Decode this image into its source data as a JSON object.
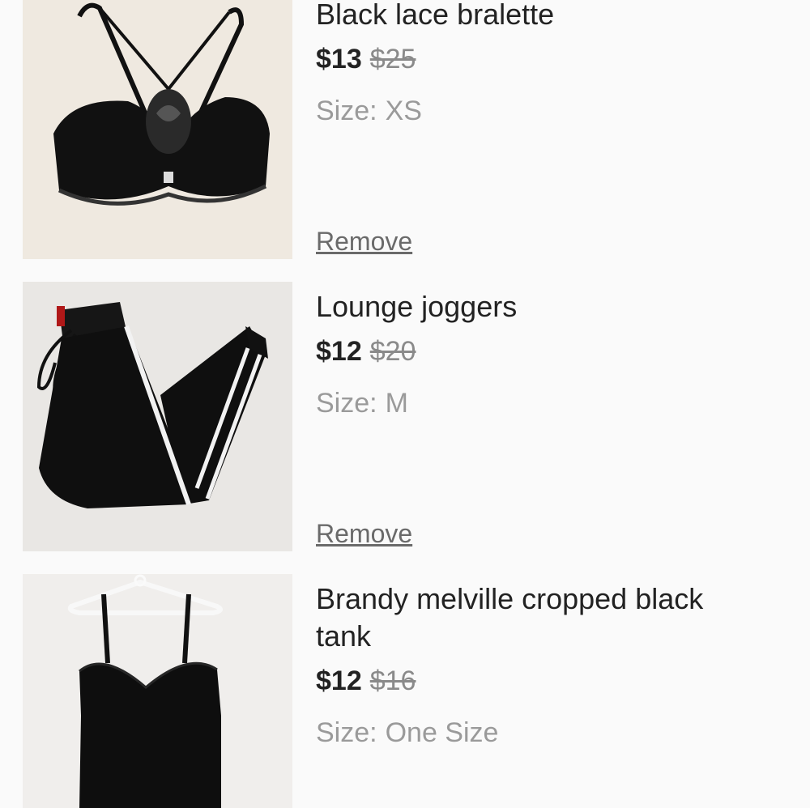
{
  "items": [
    {
      "title": "Black lace bralette",
      "price": "$13",
      "original_price": "$25",
      "size_label": "Size:",
      "size_value": "XS",
      "remove_label": "Remove",
      "image_icon": "bralette-photo"
    },
    {
      "title": "Lounge joggers",
      "price": "$12",
      "original_price": "$20",
      "size_label": "Size:",
      "size_value": "M",
      "remove_label": "Remove",
      "image_icon": "joggers-photo"
    },
    {
      "title": "Brandy melville cropped black tank",
      "price": "$12",
      "original_price": "$16",
      "size_label": "Size:",
      "size_value": "One Size",
      "image_icon": "tank-top-photo"
    }
  ],
  "colors": {
    "background": "#fafafa",
    "title": "#222222",
    "muted": "#9a9a9a",
    "strikethrough": "#8a8a8a",
    "link": "#6a6a6a"
  }
}
